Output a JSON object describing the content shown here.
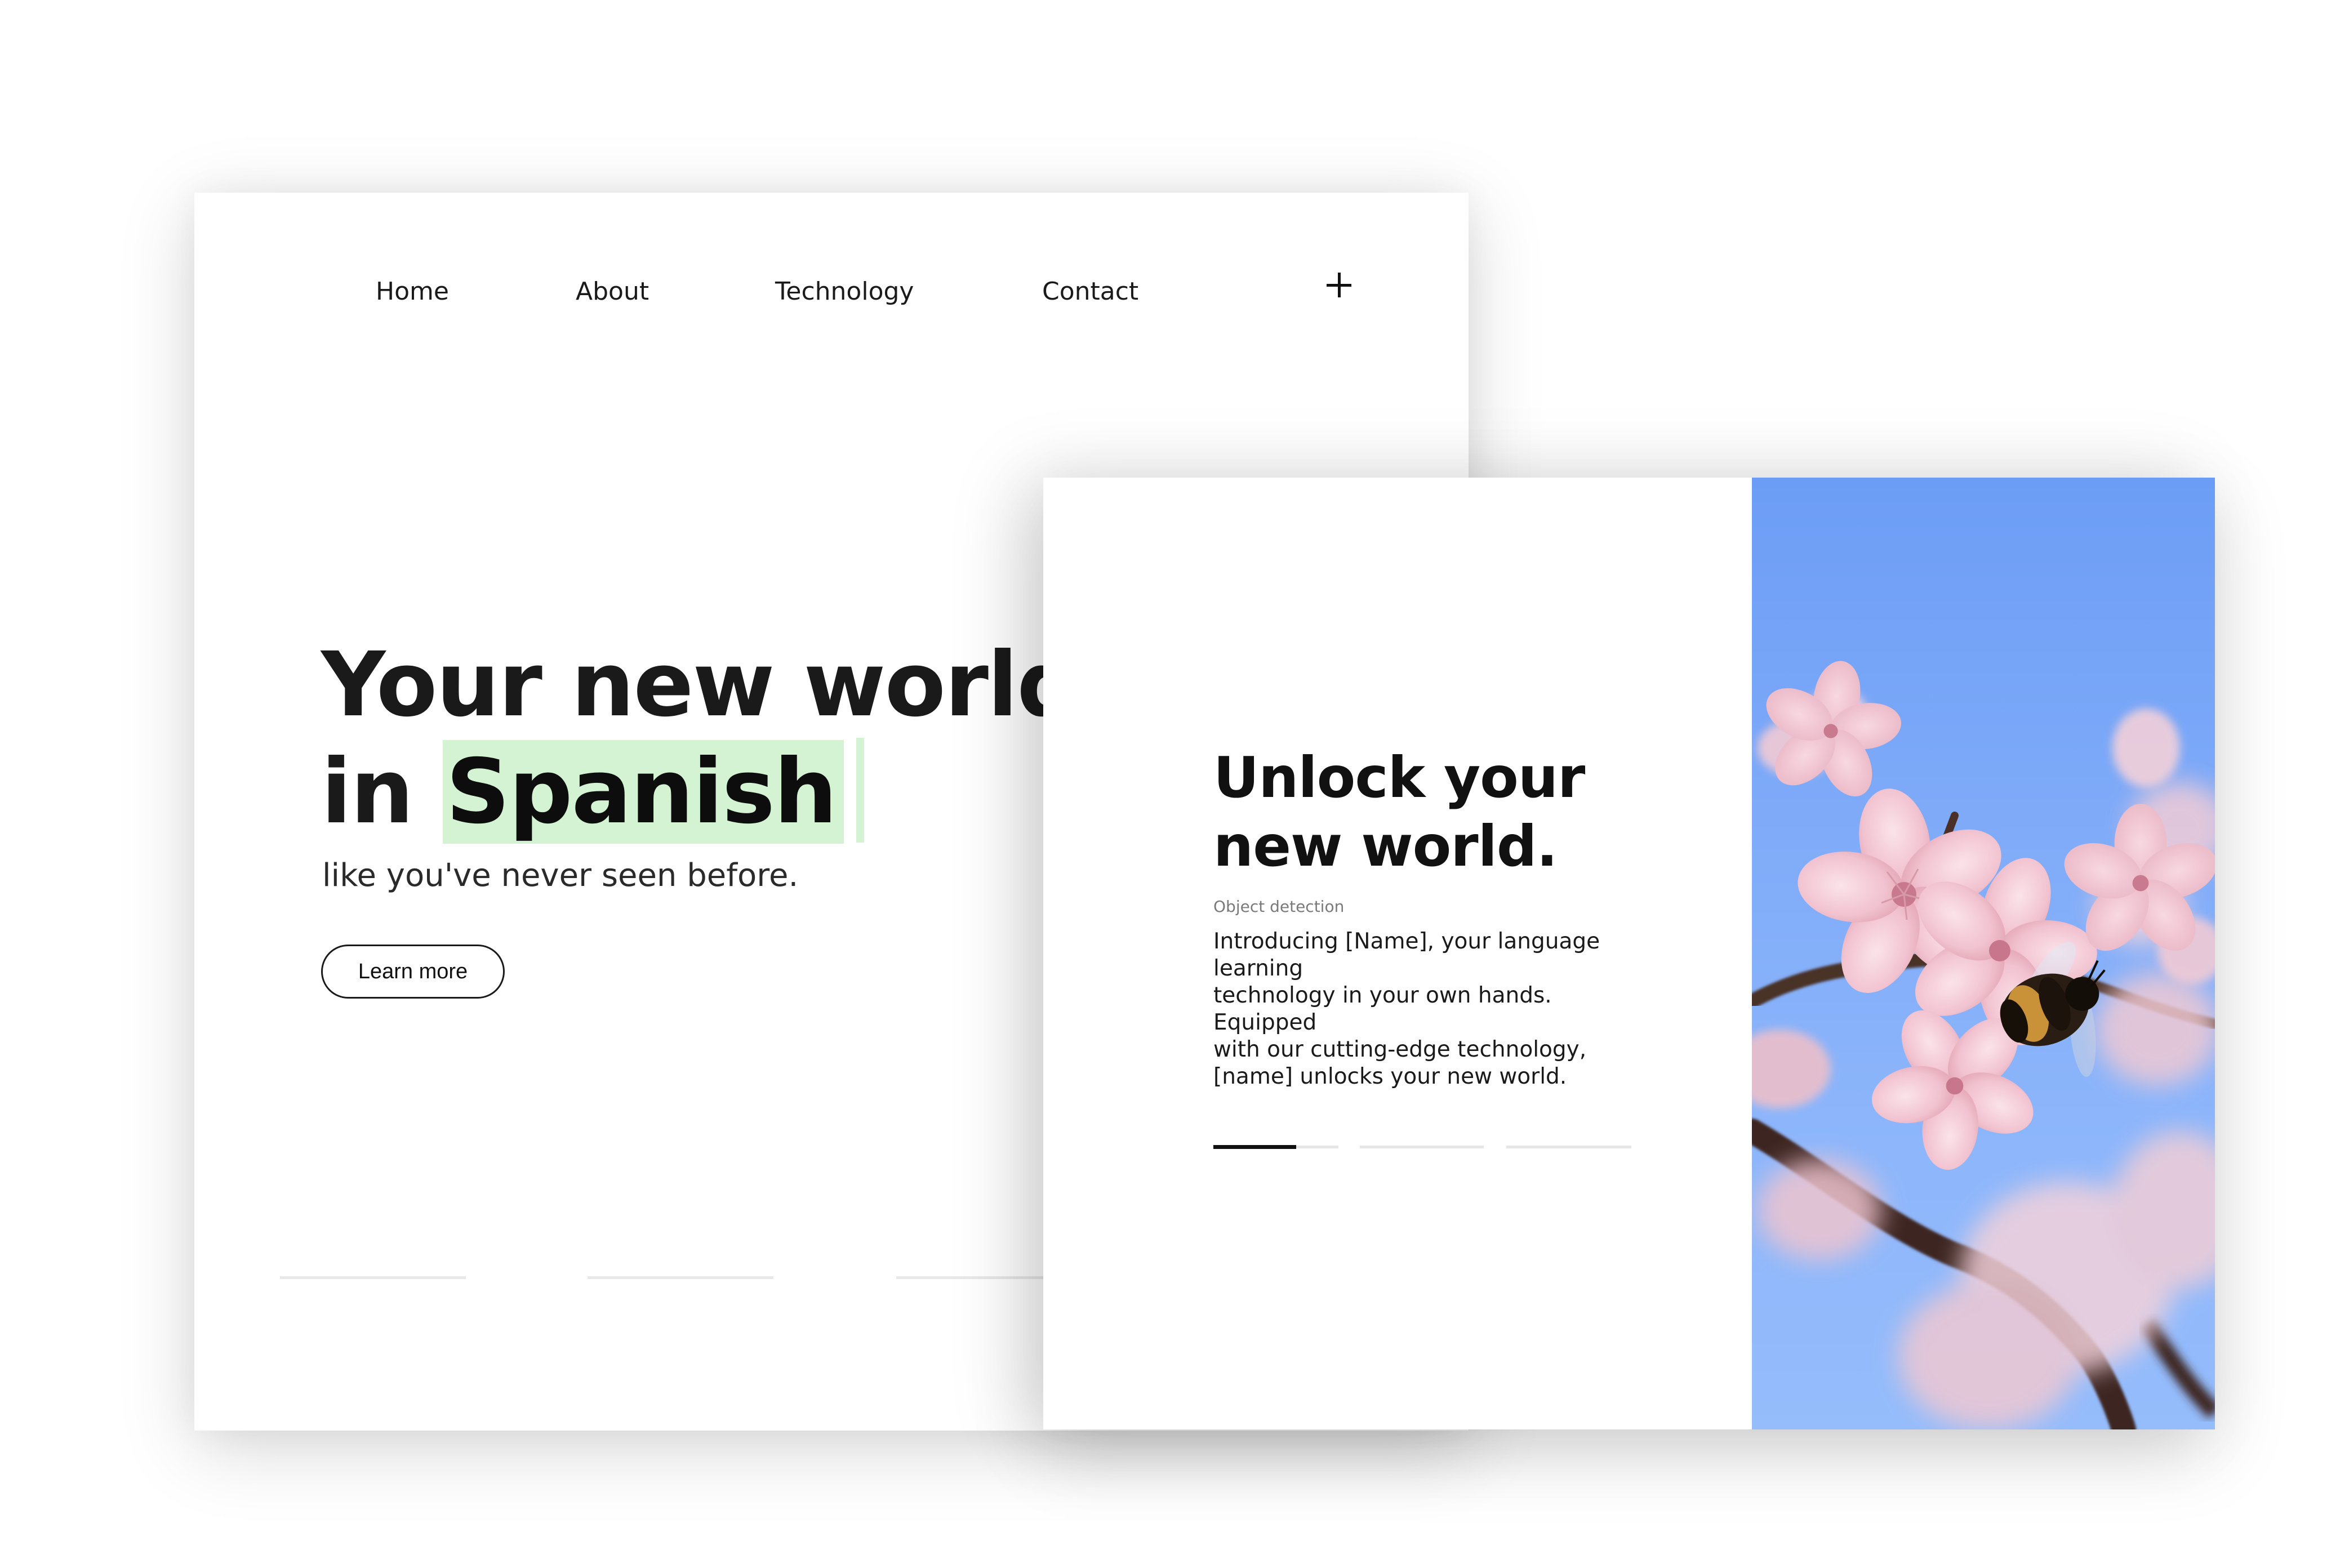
{
  "landing": {
    "nav": {
      "items": [
        "Home",
        "About",
        "Technology",
        "Contact"
      ],
      "plus_icon": "plus-icon"
    },
    "hero": {
      "title_line1": "Your new world",
      "title_prefix": "in",
      "title_highlight": "Spanish",
      "subtitle": "like you've never seen before.",
      "cta_label": "Learn more",
      "highlight_color": "#d3f3d3"
    },
    "slide_indicators": 3
  },
  "slider": {
    "title_line1": "Unlock your",
    "title_line2": "new world.",
    "tag": "Object detection",
    "body_lines": [
      "Introducing [Name], your language",
      "learning",
      "technology in your own hands.",
      "Equipped",
      "with our cutting-edge technology,",
      "[name] unlocks your new world."
    ],
    "progress": {
      "segments": 3,
      "active_segment": 1,
      "active_fill": 0.66
    },
    "image": "cherry-blossom-bee-photo"
  }
}
